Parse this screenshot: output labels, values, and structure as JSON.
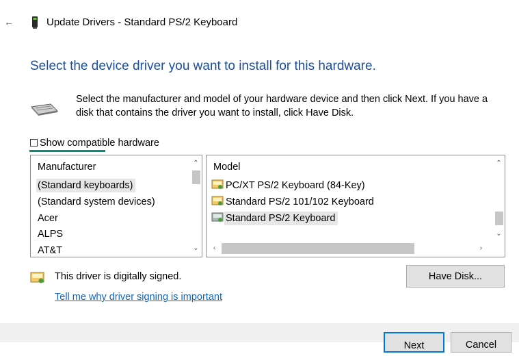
{
  "window": {
    "title": "Update Drivers - Standard PS/2 Keyboard",
    "back_icon": "back-arrow-icon",
    "title_icon": "keyboard-device-icon"
  },
  "heading": "Select the device driver you want to install for this hardware.",
  "description": "Select the manufacturer and model of your hardware device and then click Next. If you have a disk that contains the driver you want to install, click Have Disk.",
  "compatible": {
    "label": "Show compatible hardware",
    "checked": false
  },
  "manufacturer_list": {
    "header": "Manufacturer",
    "items": [
      "(Standard keyboards)",
      "(Standard system devices)",
      "Acer",
      "ALPS",
      "AT&T"
    ],
    "selected_index": 0
  },
  "model_list": {
    "header": "Model",
    "items": [
      "PC/XT PS/2 Keyboard (84-Key)",
      "Standard PS/2 101/102 Keyboard",
      "Standard PS/2 Keyboard"
    ],
    "selected_index": 2
  },
  "signed_text": "This driver is digitally signed.",
  "why_link": "Tell me why driver signing is important",
  "buttons": {
    "have_disk": "Have Disk...",
    "next": "Next",
    "cancel": "Cancel"
  },
  "colors": {
    "heading": "#1e4e9a",
    "link": "#1565b7",
    "focus": "#0b8c77",
    "primary_border": "#0078d7"
  }
}
